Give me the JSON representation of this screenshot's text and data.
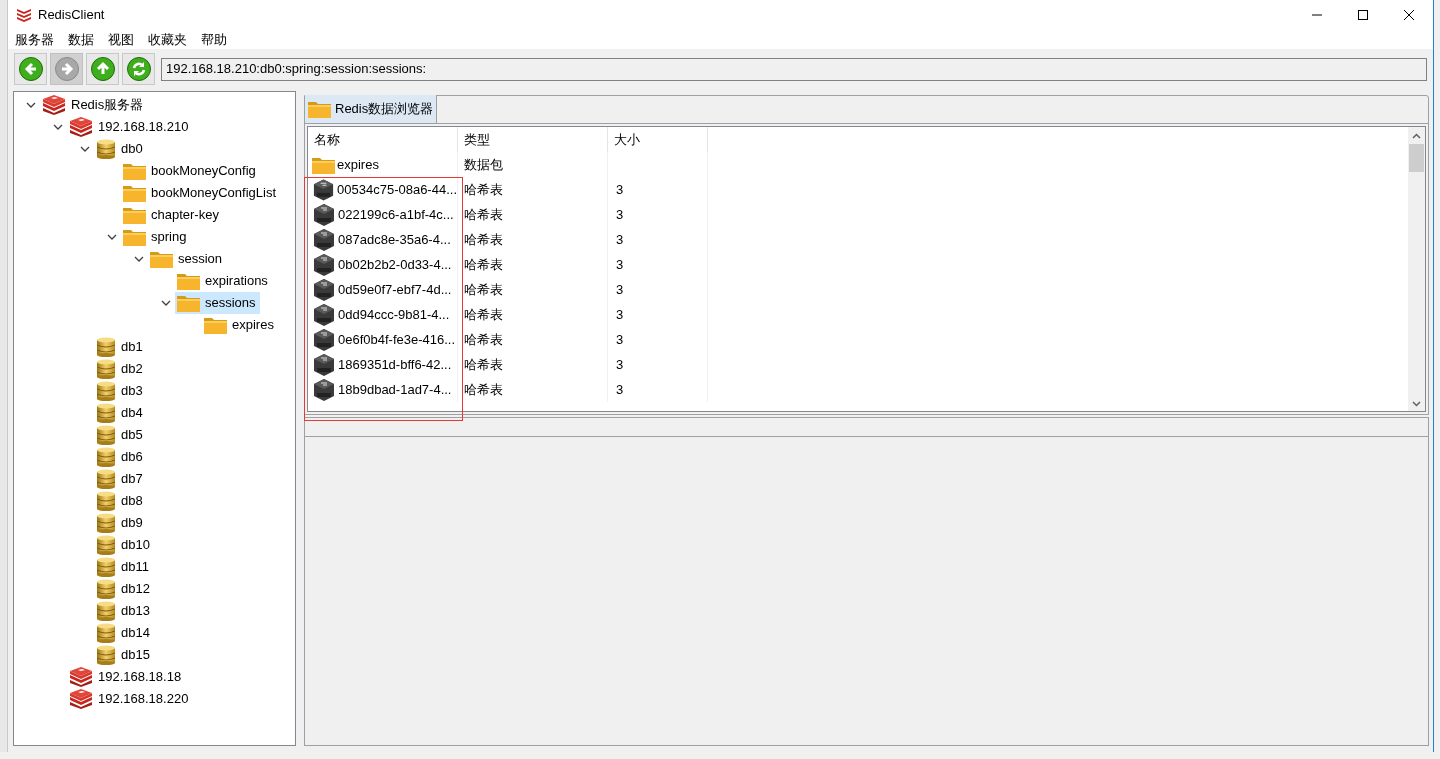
{
  "window": {
    "title": "RedisClient"
  },
  "menu": [
    "服务器",
    "数据",
    "视图",
    "收藏夹",
    "帮助"
  ],
  "toolbar": [
    {
      "kind": "back",
      "disabled": false
    },
    {
      "kind": "forward",
      "disabled": true
    },
    {
      "kind": "up",
      "disabled": false
    },
    {
      "kind": "refresh",
      "disabled": false
    }
  ],
  "address": "192.168.18.210:db0:spring:session:sessions:",
  "tree": [
    {
      "label": "Redis服务器",
      "kind": "server",
      "expanded": true,
      "selected": false,
      "children": [
        {
          "label": "192.168.18.210",
          "kind": "server",
          "expanded": true,
          "selected": false,
          "children": [
            {
              "label": "db0",
              "kind": "database",
              "expanded": true,
              "selected": false,
              "children": [
                {
                  "label": "bookMoneyConfig",
                  "kind": "folder",
                  "selected": false
                },
                {
                  "label": "bookMoneyConfigList",
                  "kind": "folder",
                  "selected": false
                },
                {
                  "label": "chapter-key",
                  "kind": "folder",
                  "selected": false
                },
                {
                  "label": "spring",
                  "kind": "folder",
                  "expanded": true,
                  "selected": false,
                  "children": [
                    {
                      "label": "session",
                      "kind": "folder",
                      "expanded": true,
                      "selected": false,
                      "children": [
                        {
                          "label": "expirations",
                          "kind": "folder",
                          "selected": false
                        },
                        {
                          "label": "sessions",
                          "kind": "folder",
                          "expanded": true,
                          "selected": true,
                          "children": [
                            {
                              "label": "expires",
                              "kind": "folder",
                              "selected": false
                            }
                          ]
                        }
                      ]
                    }
                  ]
                }
              ]
            },
            {
              "label": "db1",
              "kind": "database",
              "selected": false
            },
            {
              "label": "db2",
              "kind": "database",
              "selected": false
            },
            {
              "label": "db3",
              "kind": "database",
              "selected": false
            },
            {
              "label": "db4",
              "kind": "database",
              "selected": false
            },
            {
              "label": "db5",
              "kind": "database",
              "selected": false
            },
            {
              "label": "db6",
              "kind": "database",
              "selected": false
            },
            {
              "label": "db7",
              "kind": "database",
              "selected": false
            },
            {
              "label": "db8",
              "kind": "database",
              "selected": false
            },
            {
              "label": "db9",
              "kind": "database",
              "selected": false
            },
            {
              "label": "db10",
              "kind": "database",
              "selected": false
            },
            {
              "label": "db11",
              "kind": "database",
              "selected": false
            },
            {
              "label": "db12",
              "kind": "database",
              "selected": false
            },
            {
              "label": "db13",
              "kind": "database",
              "selected": false
            },
            {
              "label": "db14",
              "kind": "database",
              "selected": false
            },
            {
              "label": "db15",
              "kind": "database",
              "selected": false
            }
          ]
        },
        {
          "label": "192.168.18.18",
          "kind": "server",
          "selected": false
        },
        {
          "label": "192.168.18.220",
          "kind": "server",
          "selected": false
        }
      ]
    }
  ],
  "browser": {
    "tab": "Redis数据浏览器",
    "columns": [
      "名称",
      "类型",
      "大小"
    ],
    "rows": [
      {
        "kind": "folder",
        "name": "expires",
        "type": "数据包"
      },
      {
        "kind": "hash",
        "name": "00534c75-08a6-44...",
        "type": "哈希表",
        "size": "3"
      },
      {
        "kind": "hash",
        "name": "022199c6-a1bf-4c...",
        "type": "哈希表",
        "size": "3"
      },
      {
        "kind": "hash",
        "name": "087adc8e-35a6-4...",
        "type": "哈希表",
        "size": "3"
      },
      {
        "kind": "hash",
        "name": "0b02b2b2-0d33-4...",
        "type": "哈希表",
        "size": "3"
      },
      {
        "kind": "hash",
        "name": "0d59e0f7-ebf7-4d...",
        "type": "哈希表",
        "size": "3"
      },
      {
        "kind": "hash",
        "name": "0dd94ccc-9b81-4...",
        "type": "哈希表",
        "size": "3"
      },
      {
        "kind": "hash",
        "name": "0e6f0b4f-fe3e-416...",
        "type": "哈希表",
        "size": "3"
      },
      {
        "kind": "hash",
        "name": "1869351d-bff6-42...",
        "type": "哈希表",
        "size": "3"
      },
      {
        "kind": "hash",
        "name": "18b9dbad-1ad7-4...",
        "type": "哈希表",
        "size": "3"
      }
    ]
  },
  "annotation": {
    "kind": "rectangle"
  }
}
